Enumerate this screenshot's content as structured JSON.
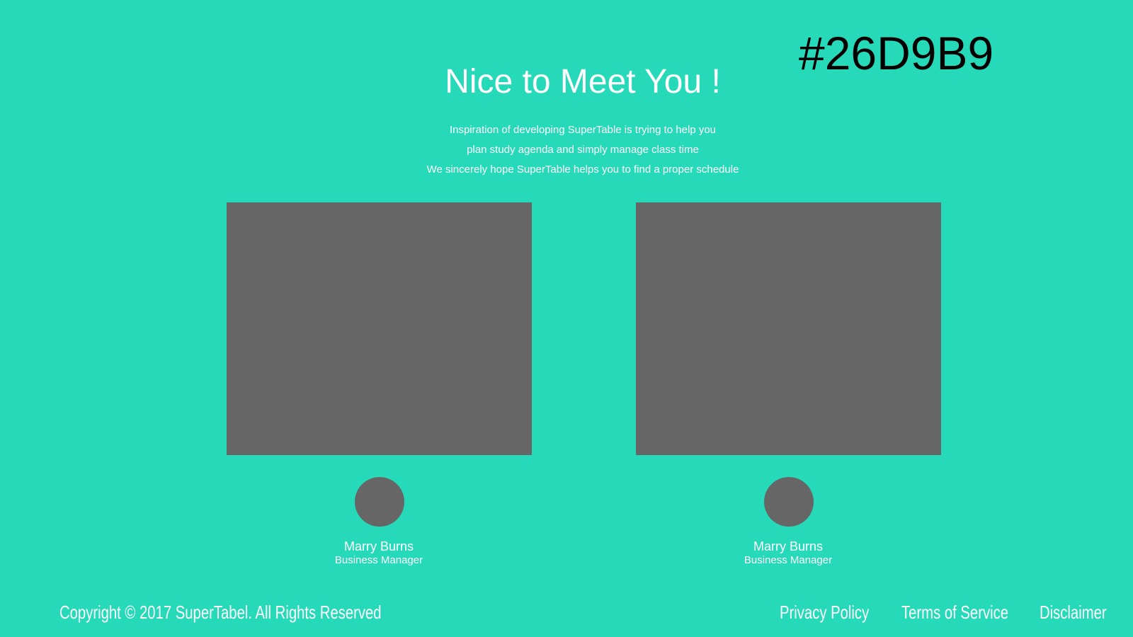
{
  "colors": {
    "background": "#26D9B9",
    "placeholder": "#666666",
    "text": "#ffffff",
    "hex_label": "#000000"
  },
  "hex_label": "#26D9B9",
  "header": {
    "title": "Nice to Meet You !",
    "subtitle_lines": [
      "Inspiration of developing SuperTable is trying to help you",
      "plan study agenda and simply manage class time",
      "We sincerely hope SuperTable helps you to find a proper schedule"
    ]
  },
  "team": [
    {
      "name": "Marry Burns",
      "role": "Business Manager"
    },
    {
      "name": "Marry Burns",
      "role": "Business Manager"
    }
  ],
  "footer": {
    "copyright": "Copyright © 2017 SuperTabel. All Rights Reserved",
    "links": [
      "Privacy Policy",
      "Terms of Service",
      "Disclaimer"
    ]
  }
}
